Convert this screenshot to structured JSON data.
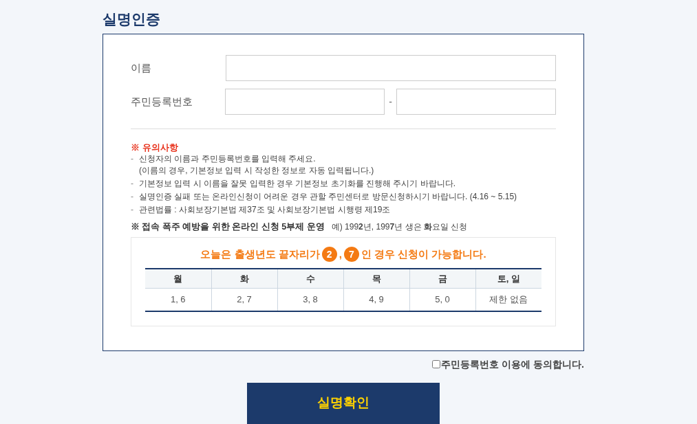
{
  "title": "실명인증",
  "fields": [
    {
      "label": "이름",
      "kind": "single"
    },
    {
      "label": "주민등록번호",
      "kind": "split",
      "separator": "-"
    }
  ],
  "notes": {
    "heading": "※ 유의사항",
    "items": [
      {
        "lines": [
          "신청자의 이름과 주민등록번호를 입력해 주세요.",
          "(이름의 경우, 기본정보 입력 시 작성한 정보로 자동 입력됩니다.)"
        ]
      },
      {
        "lines": [
          "기본정보 입력 시 이름을 잘못 입력한 경우 기본정보 초기화를 진행해 주시기 바랍니다."
        ]
      },
      {
        "lines": [
          "실명인증 실패 또는 온라인신청이 어려운 경우 관할 주민센터로 방문신청하시기 바랍니다. (4.16 ~ 5.15)"
        ]
      },
      {
        "lines": [
          "관련법률 : 사회보장기본법 제37조 및 사회보장기본법 시행령 제19조"
        ]
      }
    ],
    "bullet": "-"
  },
  "rotation": {
    "heading": "※ 접속 폭주 예방을 위한 온라인 신청 5부제 운영",
    "example": "예) 199**2**년, 199**7**년 생은 **화**요일 신청"
  },
  "notice": {
    "before": "오늘은 출생년도 끝자리가",
    "digits": [
      "2",
      "7"
    ],
    "separator": ",",
    "after": "인 경우 신청이 가능합니다."
  },
  "table": {
    "columns": [
      "월",
      "화",
      "수",
      "목",
      "금",
      "토, 일"
    ],
    "rows": [
      [
        "1, 6",
        "2, 7",
        "3, 8",
        "4, 9",
        "5, 0",
        "제한 없음"
      ]
    ]
  },
  "consent": {
    "label": "주민등록번호 이용에 동의합니다.",
    "checked": false
  },
  "submit": "실명확인"
}
